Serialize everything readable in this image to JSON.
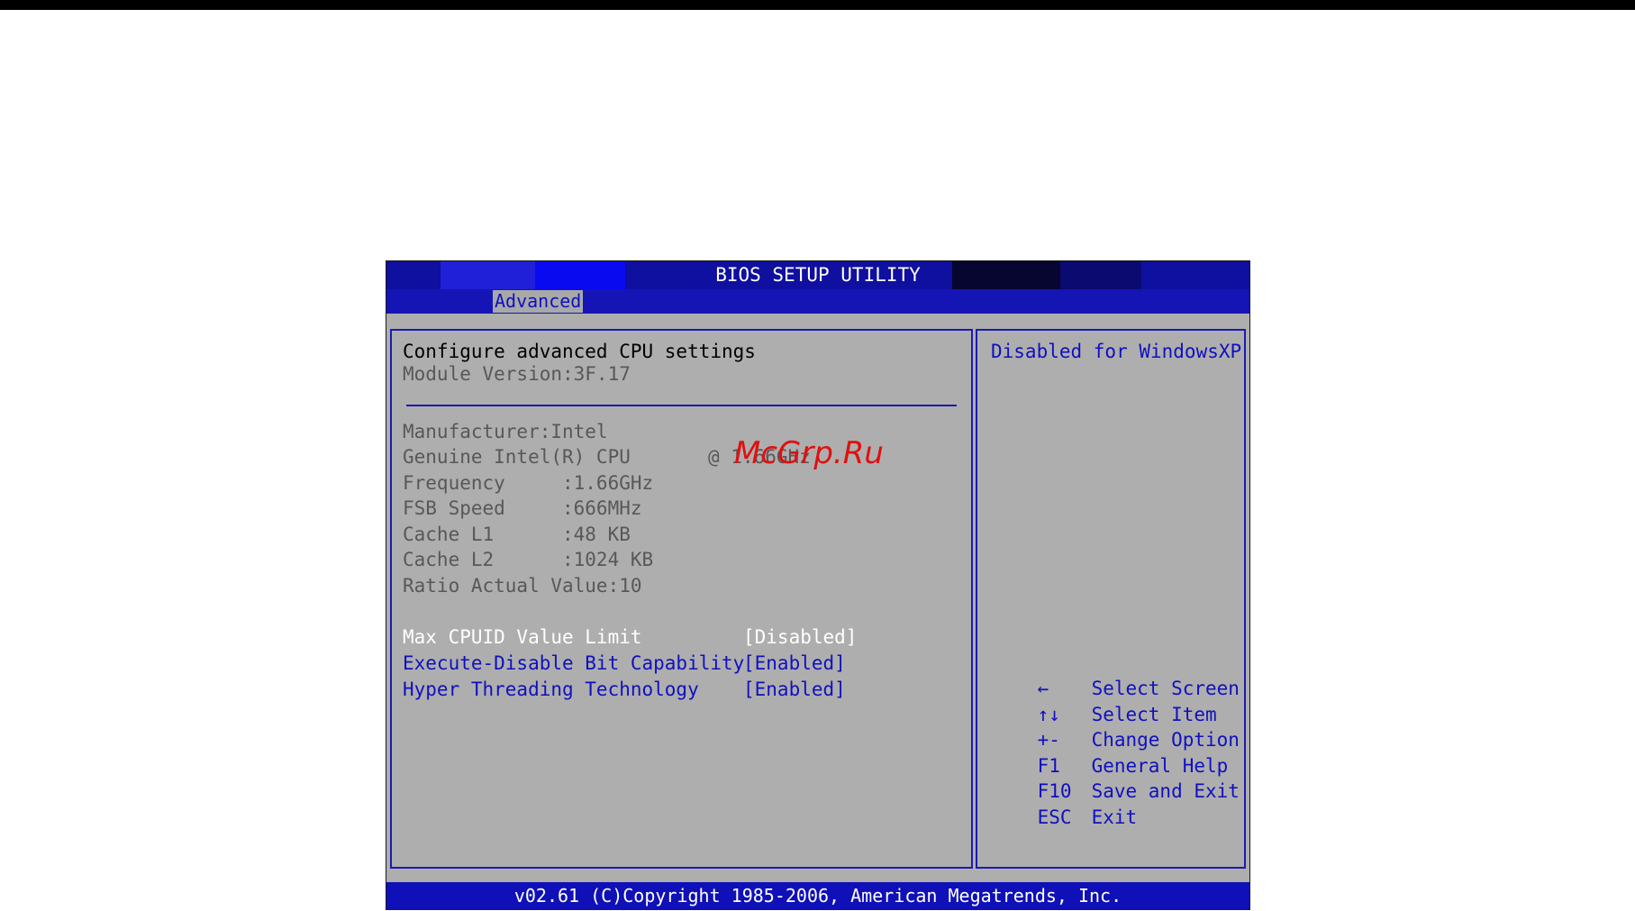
{
  "title": "BIOS SETUP UTILITY",
  "tabs": [
    {
      "label": "Advanced",
      "active": true
    }
  ],
  "main": {
    "heading": "Configure advanced CPU settings",
    "module_version": "Module Version:3F.17",
    "info": [
      "Manufacturer:Intel",
      "Genuine Intel(R) CPU",
      "Frequency     :1.66GHz",
      "FSB Speed     :666MHz",
      "Cache L1      :48 KB",
      "Cache L2      :1024 KB",
      "Ratio Actual Value:10"
    ],
    "cpu_speed_suffix": "@ 1.66GHz",
    "settings": [
      {
        "label": "Max CPUID Value Limit",
        "value": "[Disabled]",
        "selected": true
      },
      {
        "label": "Execute-Disable Bit Capability",
        "value": "[Enabled]",
        "selected": false
      },
      {
        "label": "Hyper Threading Technology",
        "value": "[Enabled]",
        "selected": false
      }
    ]
  },
  "help": {
    "text": "Disabled for WindowsXP",
    "keys": [
      {
        "key": "←",
        "action": "Select Screen"
      },
      {
        "key": "↑↓",
        "action": "Select Item"
      },
      {
        "key": "+-",
        "action": "Change Option"
      },
      {
        "key": "F1",
        "action": "General Help"
      },
      {
        "key": "F10",
        "action": "Save and Exit"
      },
      {
        "key": "ESC",
        "action": "Exit"
      }
    ]
  },
  "footer": "v02.61 (C)Copyright 1985-2006, American Megatrends, Inc.",
  "watermark": "McGrp.Ru",
  "colors": {
    "title_bar": "#0f0fa0",
    "panel_bg": "#aeaeae",
    "accent_blue": "#1010c0",
    "highlight": "#ffffff",
    "watermark": "#e01010"
  }
}
